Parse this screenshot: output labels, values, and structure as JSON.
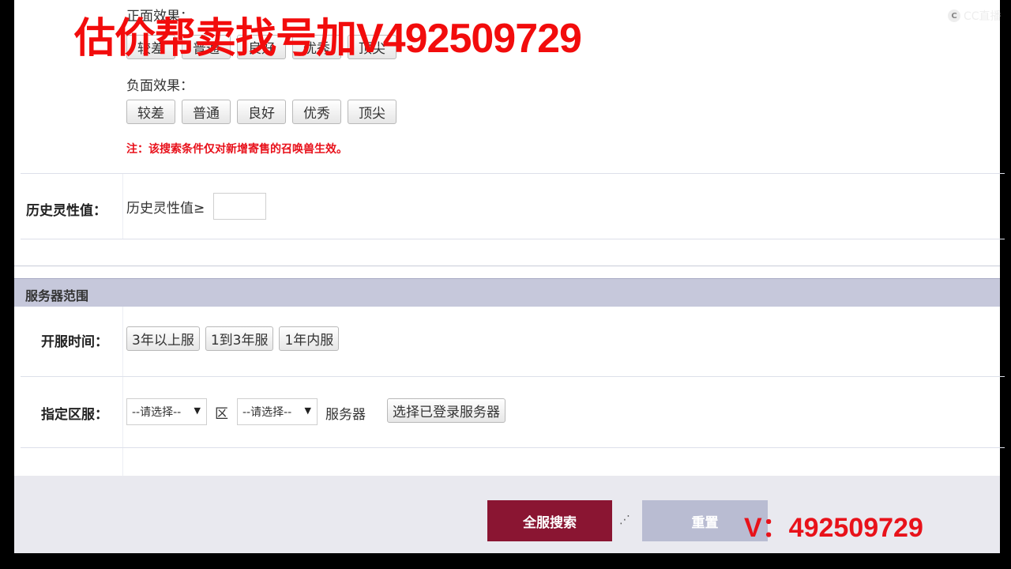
{
  "watermark": {
    "top": "估价帮卖找号加V492509729",
    "bottom": "V：492509729",
    "logo_text": "CC直播"
  },
  "positive_effect": {
    "label": "正面效果：",
    "options": [
      "较差",
      "普通",
      "良好",
      "优秀",
      "顶尖"
    ]
  },
  "negative_effect": {
    "label": "负面效果：",
    "options": [
      "较差",
      "普通",
      "良好",
      "优秀",
      "顶尖"
    ]
  },
  "note": "注：该搜索条件仅对新增寄售的召唤兽生效。",
  "history_spirit": {
    "label": "历史灵性值：",
    "field_label": "历史灵性值≥",
    "value": ""
  },
  "server_section": {
    "title": "服务器范围"
  },
  "open_time": {
    "label": "开服时间：",
    "options": [
      "3年以上服",
      "1到3年服",
      "1年内服"
    ]
  },
  "server_select": {
    "label": "指定区服：",
    "area_value": "--请选择--",
    "area_suffix": "区",
    "server_value": "--请选择--",
    "server_suffix": "服务器",
    "choose_button": "选择已登录服务器"
  },
  "actions": {
    "search": "全服搜索",
    "reset": "重置"
  }
}
